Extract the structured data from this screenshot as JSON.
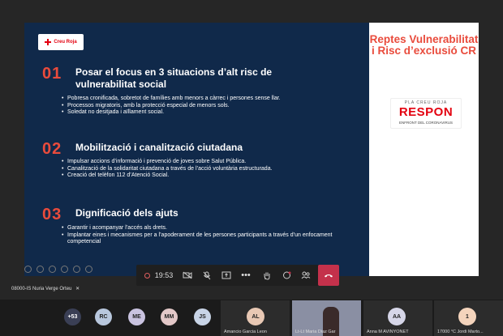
{
  "slide": {
    "logo": "Creu Roja",
    "sections": [
      {
        "num": "01",
        "title": "Posar el focus en 3 situacions d’alt risc de vulnerabilitat social",
        "bullets": [
          "Pobresa cronificada, sobretot de famílies amb menors a càrrec  i persones sense llar.",
          "Processos migratoris, amb la protecció especial de menors sols.",
          "Soledat no desitjada i aïllament social."
        ]
      },
      {
        "num": "02",
        "title": "Mobilització i canalització ciutadana",
        "bullets": [
          "Impulsar accions d’informació i prevenció de joves sobre Salut Pública.",
          "Canalització de la solidaritat ciutadana a través de l’acció voluntària estructurada.",
          "Creació del telèfon 112 d’Atenció Social."
        ]
      },
      {
        "num": "03",
        "title": "Dignificació dels ajuts",
        "bullets": [
          "Garantir i acompanyar l’accés als drets.",
          "Implantar eines i mecanismes  per a l’apoderament de les persones participants a través d’un enfocament competencial"
        ]
      }
    ],
    "side": {
      "title": "Reptes Vulnerabilitat i Risc d’exclusió CR",
      "pla": "PLA CREU ROJA",
      "respon": "RESPON",
      "enfront": "ENFRONT DEL CORONAVIRUS"
    }
  },
  "meeting_bar": {
    "timer": "19:53",
    "buttons": [
      "record",
      "video-off",
      "mic-off",
      "share",
      "more",
      "raise-hand",
      "chat",
      "participants",
      "hang-up"
    ]
  },
  "presenter_caption": "08000-IS Nuria Verge Orteu",
  "participants": {
    "more_count": "+53",
    "avatars": [
      {
        "initials": "RC",
        "color": "#b8c7dd"
      },
      {
        "initials": "ME",
        "color": "#c9c3e0"
      },
      {
        "initials": "MM",
        "color": "#e3c8c8"
      },
      {
        "initials": "JS",
        "color": "#c8d4e6"
      }
    ],
    "tiles": [
      {
        "initials": "AL",
        "name": "Amancio Garcia Leon",
        "color": "#e8c8b4"
      },
      {
        "initials": "",
        "name": "Lt-Lt Maria Diaz Gar",
        "color": ""
      },
      {
        "initials": "AA",
        "name": "Anna M AVINYONET",
        "color": "#d6d6e8"
      },
      {
        "initials": "1",
        "name": "17000 °C Jordi Marto...",
        "color": "#f4d4bc"
      }
    ]
  }
}
